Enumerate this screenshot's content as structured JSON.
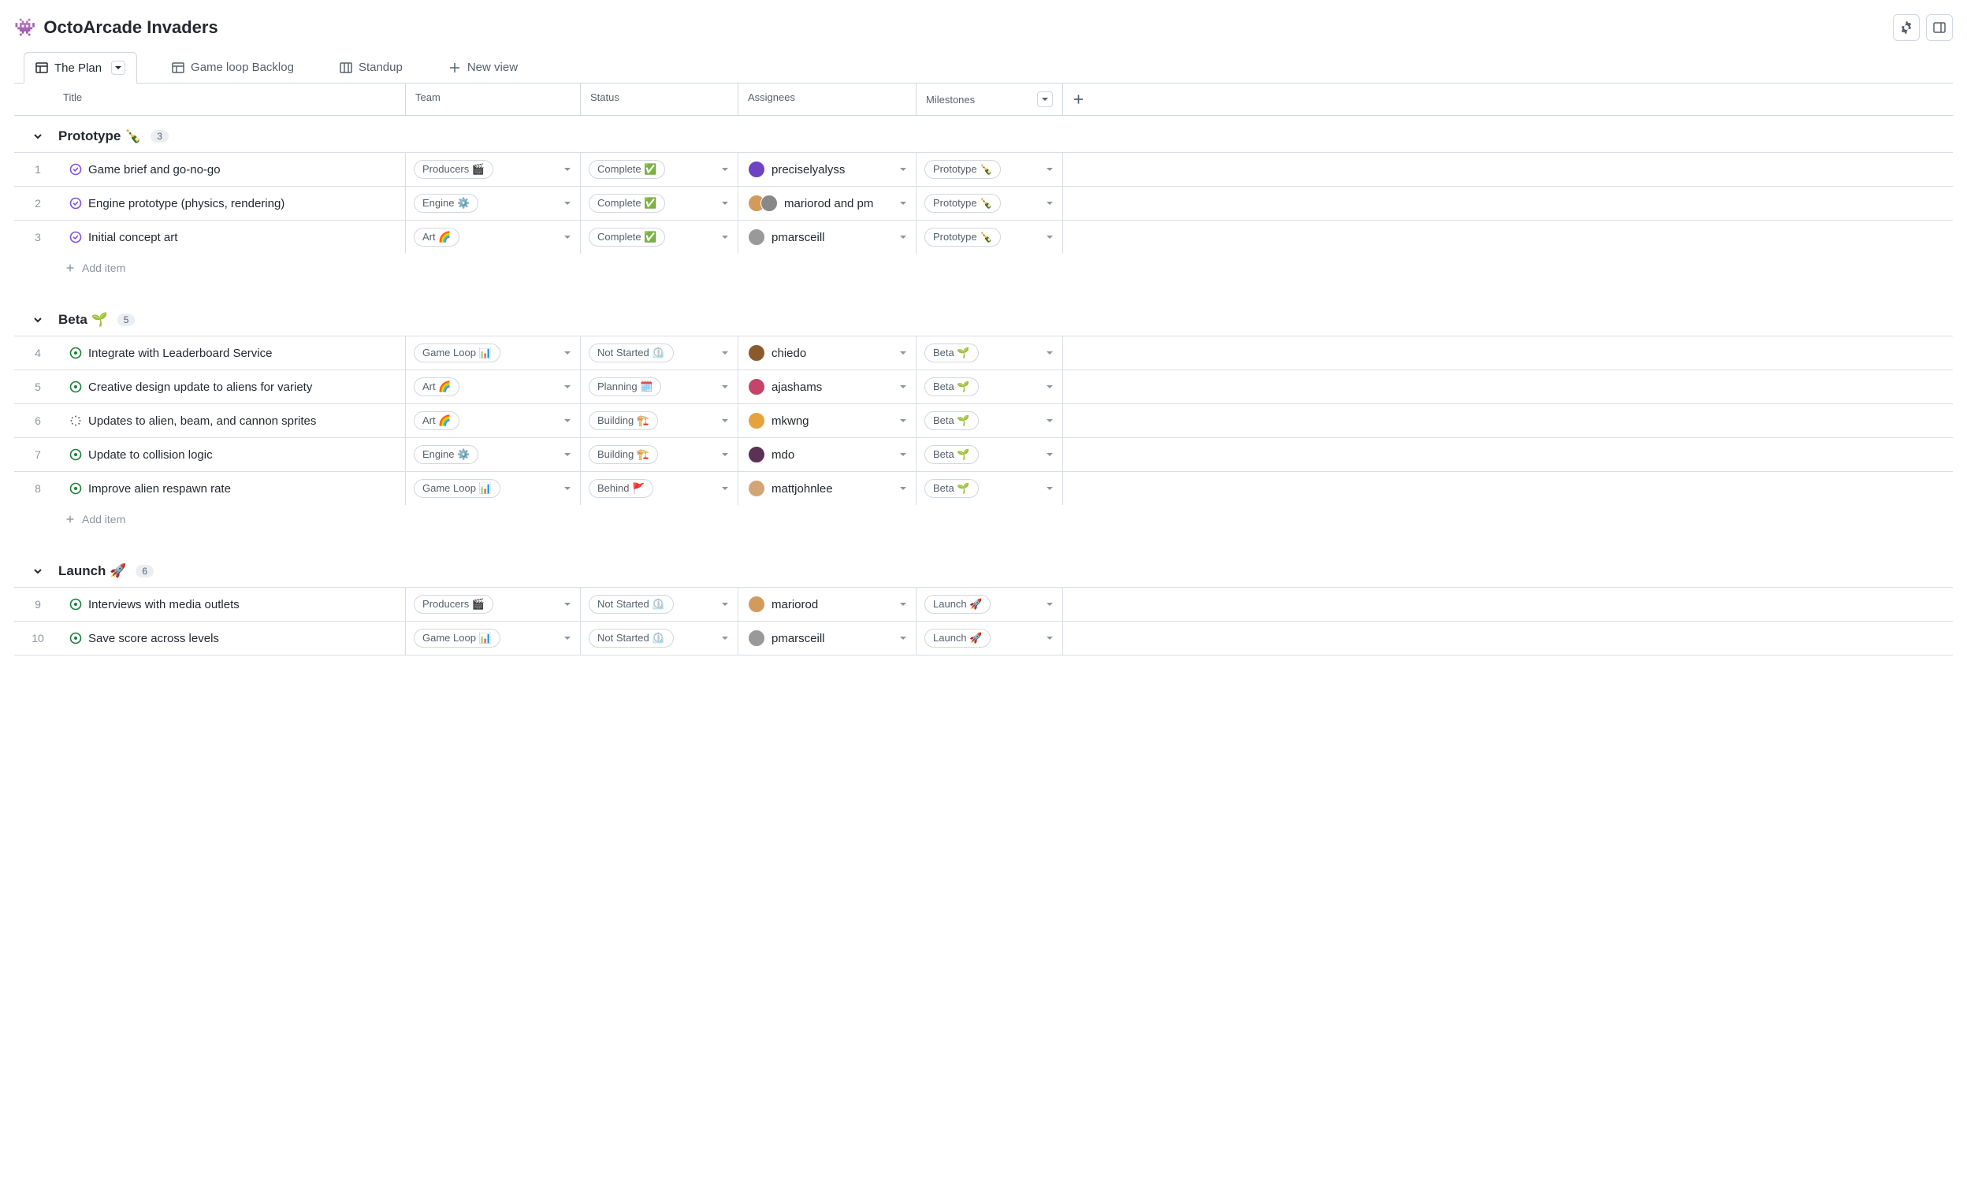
{
  "header": {
    "emoji": "👾",
    "title": "OctoArcade Invaders"
  },
  "tabs": [
    {
      "label": "The Plan",
      "icon": "table",
      "active": true,
      "caret": true
    },
    {
      "label": "Game loop Backlog",
      "icon": "table",
      "active": false
    },
    {
      "label": "Standup",
      "icon": "board",
      "active": false
    },
    {
      "label": "New view",
      "icon": "plus",
      "active": false
    }
  ],
  "columns": {
    "title": "Title",
    "team": "Team",
    "status": "Status",
    "assignees": "Assignees",
    "milestones": "Milestones"
  },
  "add_item_label": "Add item",
  "groups": [
    {
      "name": "Prototype",
      "emoji": "🍾",
      "count": "3",
      "items": [
        {
          "num": "1",
          "icon": "closed",
          "title": "Game brief and go-no-go",
          "team": "Producers 🎬",
          "status": "Complete ✅",
          "assignees": "preciselyalyss",
          "avcolors": [
            "#6f42c1"
          ],
          "milestone": "Prototype 🍾"
        },
        {
          "num": "2",
          "icon": "closed",
          "title": "Engine prototype (physics, rendering)",
          "team": "Engine ⚙️",
          "status": "Complete ✅",
          "assignees": "mariorod and pm",
          "avcolors": [
            "#d29b5c",
            "#888"
          ],
          "milestone": "Prototype 🍾"
        },
        {
          "num": "3",
          "icon": "closed",
          "title": "Initial concept art",
          "team": "Art 🌈",
          "status": "Complete ✅",
          "assignees": "pmarsceill",
          "avcolors": [
            "#999"
          ],
          "milestone": "Prototype 🍾"
        }
      ]
    },
    {
      "name": "Beta",
      "emoji": "🌱",
      "count": "5",
      "items": [
        {
          "num": "4",
          "icon": "open",
          "title": "Integrate with Leaderboard Service",
          "team": "Game Loop 📊",
          "status": "Not Started ⏲️",
          "assignees": "chiedo",
          "avcolors": [
            "#8b5a2b"
          ],
          "milestone": "Beta 🌱"
        },
        {
          "num": "5",
          "icon": "open",
          "title": "Creative design update to aliens for variety",
          "team": "Art 🌈",
          "status": "Planning 🗓️",
          "assignees": "ajashams",
          "avcolors": [
            "#c44569"
          ],
          "milestone": "Beta 🌱"
        },
        {
          "num": "6",
          "icon": "draft",
          "title": "Updates to alien, beam, and cannon sprites",
          "team": "Art 🌈",
          "status": "Building 🏗️",
          "assignees": "mkwng",
          "avcolors": [
            "#e6a23c"
          ],
          "milestone": "Beta 🌱"
        },
        {
          "num": "7",
          "icon": "open",
          "title": "Update to collision logic",
          "team": "Engine ⚙️",
          "status": "Building 🏗️",
          "assignees": "mdo",
          "avcolors": [
            "#5b3256"
          ],
          "milestone": "Beta 🌱"
        },
        {
          "num": "8",
          "icon": "open",
          "title": "Improve alien respawn rate",
          "team": "Game Loop 📊",
          "status": "Behind 🚩",
          "assignees": "mattjohnlee",
          "avcolors": [
            "#d4a574"
          ],
          "milestone": "Beta 🌱"
        }
      ]
    },
    {
      "name": "Launch",
      "emoji": "🚀",
      "count": "6",
      "items": [
        {
          "num": "9",
          "icon": "open",
          "title": "Interviews with media outlets",
          "team": "Producers 🎬",
          "status": "Not Started ⏲️",
          "assignees": "mariorod",
          "avcolors": [
            "#d29b5c"
          ],
          "milestone": "Launch 🚀"
        },
        {
          "num": "10",
          "icon": "open",
          "title": "Save score across levels",
          "team": "Game Loop 📊",
          "status": "Not Started ⏲️",
          "assignees": "pmarsceill",
          "avcolors": [
            "#999"
          ],
          "milestone": "Launch 🚀"
        }
      ]
    }
  ]
}
